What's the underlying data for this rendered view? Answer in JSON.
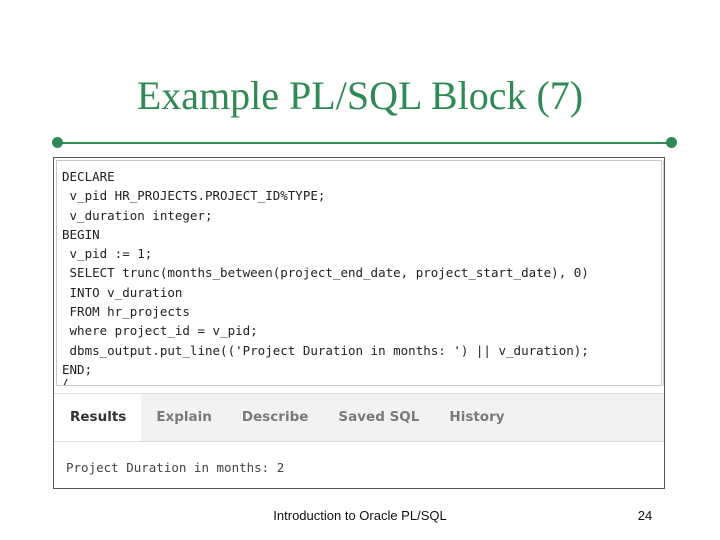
{
  "slide": {
    "title": "Example PL/SQL Block (7)",
    "footer": "Introduction to Oracle PL/SQL",
    "page_number": "24"
  },
  "editor": {
    "lines": [
      "DECLARE",
      " v_pid HR_PROJECTS.PROJECT_ID%TYPE;",
      " v_duration integer;",
      "BEGIN",
      " v_pid := 1;",
      " SELECT trunc(months_between(project_end_date, project_start_date), 0)",
      " INTO v_duration",
      " FROM hr_projects",
      " where project_id = v_pid;",
      " dbms_output.put_line(('Project Duration in months: ') || v_duration);",
      "END;",
      "/"
    ]
  },
  "results": {
    "tabs": [
      "Results",
      "Explain",
      "Describe",
      "Saved SQL",
      "History"
    ],
    "active_tab": "Results",
    "output": "Project Duration in months: 2"
  },
  "colors": {
    "title_green": "#2f8a55",
    "tab_bar_bg": "#f2f2f2"
  }
}
